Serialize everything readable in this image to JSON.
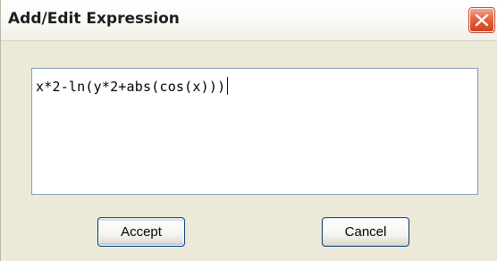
{
  "dialog": {
    "title": "Add/Edit Expression",
    "close_icon": "close-icon"
  },
  "expression": {
    "value": "x*2-ln(y*2+abs(cos(x)))"
  },
  "buttons": {
    "accept_label": "Accept",
    "cancel_label": "Cancel"
  },
  "colors": {
    "dialog_background": "#ece9d8",
    "close_button": "#d0441f",
    "input_border": "#7f9db9",
    "default_button_border": "#003c74"
  }
}
